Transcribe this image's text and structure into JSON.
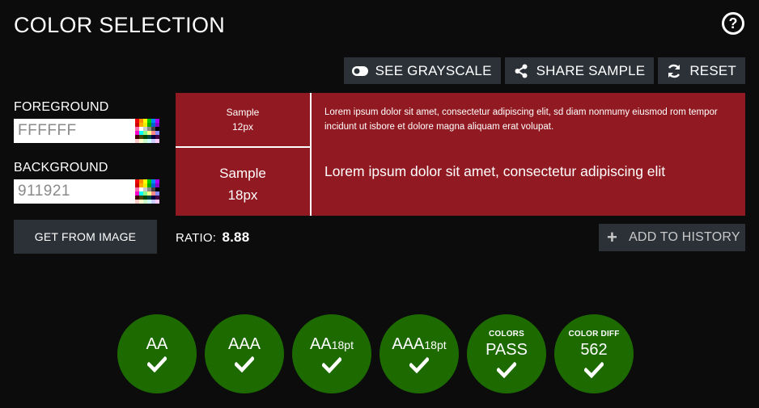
{
  "header": {
    "title": "COLOR SELECTION",
    "help_icon": "question-circle-icon"
  },
  "toolbar": {
    "grayscale_label": "SEE GRAYSCALE",
    "share_label": "SHARE SAMPLE",
    "reset_label": "RESET"
  },
  "foreground": {
    "label": "FOREGROUND",
    "value": "FFFFFF"
  },
  "background": {
    "label": "BACKGROUND",
    "value": "911921"
  },
  "get_from_image_label": "GET FROM IMAGE",
  "sample": {
    "bg_color": "#911921",
    "fg_color": "#FFFFFF",
    "small_title": "Sample",
    "small_size": "12px",
    "large_title": "Sample",
    "large_size": "18px",
    "small_text": "Lorem ipsum dolor sit amet, consectetur adipiscing elit, sd diam nonmumy eiusmod rom tempor incidunt ut isbore et dolore magna aliquam erat volupat.",
    "large_text": "Lorem ipsum dolor sit amet, consectetur adipiscing elit"
  },
  "ratio": {
    "label": "RATIO:",
    "value": "8.88"
  },
  "add_history_label": "ADD TO HISTORY",
  "results": {
    "pass_color": "#1d6b00",
    "items": [
      {
        "caption": "",
        "main": "AA",
        "suffix": ""
      },
      {
        "caption": "",
        "main": "AAA",
        "suffix": ""
      },
      {
        "caption": "",
        "main": "AA",
        "suffix": "18pt"
      },
      {
        "caption": "",
        "main": "AAA",
        "suffix": "18pt"
      },
      {
        "caption": "COLORS",
        "main": "PASS",
        "suffix": ""
      },
      {
        "caption": "COLOR DIFF",
        "main": "562",
        "suffix": ""
      }
    ]
  }
}
